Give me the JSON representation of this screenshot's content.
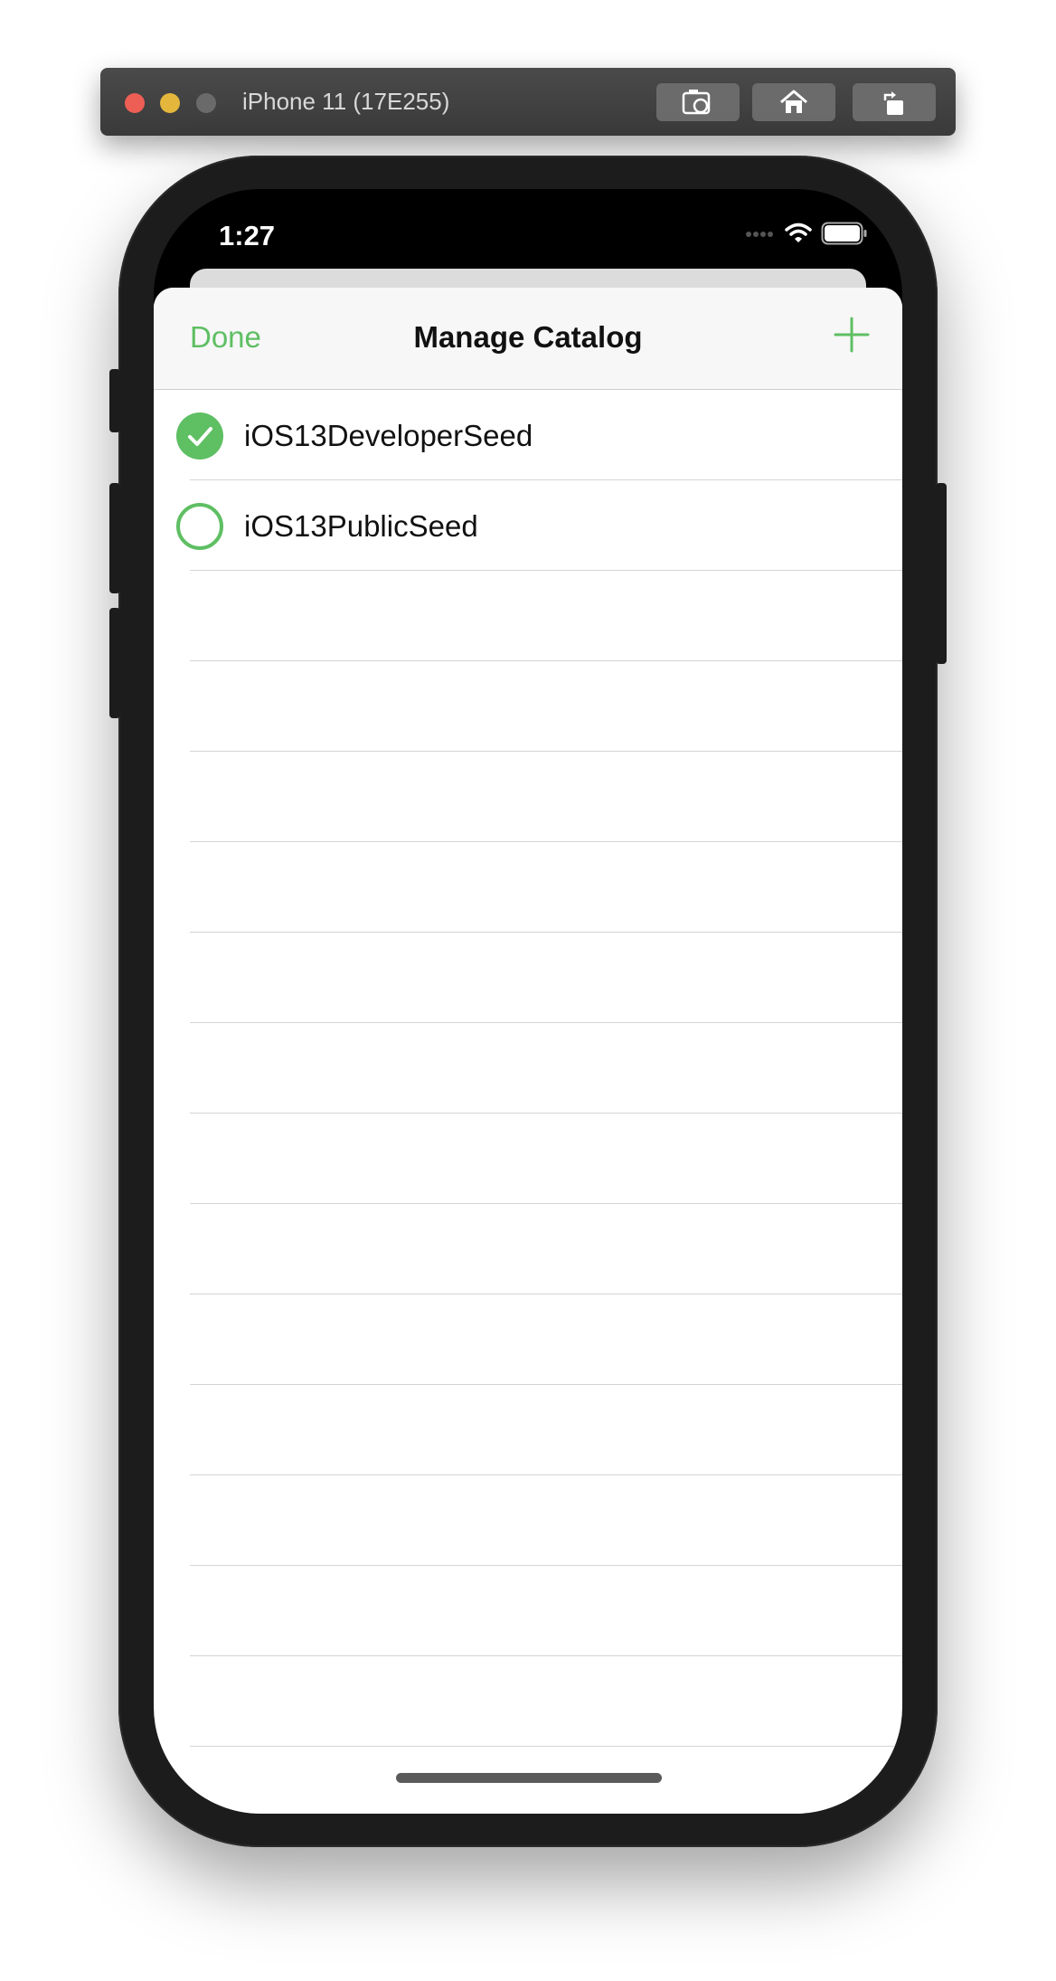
{
  "simulator": {
    "title": "iPhone 11 (17E255)",
    "buttons": [
      "screenshot-icon",
      "home-icon",
      "rotate-icon"
    ]
  },
  "status_bar": {
    "time": "1:27",
    "icons": [
      "cellular-signal-icon",
      "wifi-icon",
      "battery-icon"
    ]
  },
  "nav": {
    "done_label": "Done",
    "title": "Manage Catalog",
    "add_icon": "plus-icon"
  },
  "catalogs": [
    {
      "label": "iOS13DeveloperSeed",
      "selected": true
    },
    {
      "label": "iOS13PublicSeed",
      "selected": false
    }
  ],
  "colors": {
    "accent": "#5fbf63",
    "text": "#111111",
    "separator": "#d4d4d4",
    "phone_body": "#1c1c1c"
  }
}
